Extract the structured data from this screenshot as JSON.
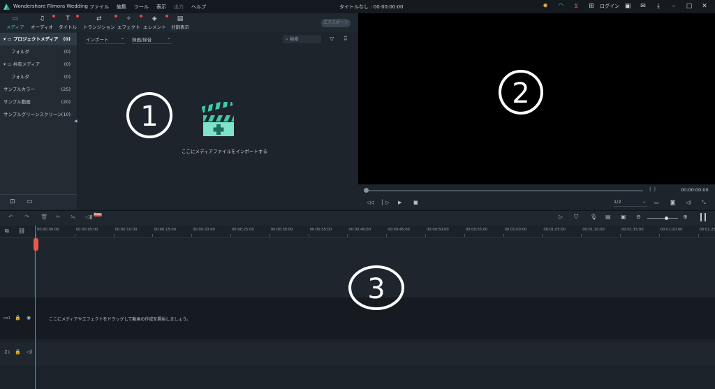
{
  "app": {
    "name": "Wondershare Filmora Wedding",
    "document_title": "タイトルなし : 00:00:00:00"
  },
  "menu": [
    "ファイル",
    "編集",
    "ツール",
    "表示",
    "出力",
    "ヘルプ"
  ],
  "titlebar_icons": {
    "login_label": "ログイン"
  },
  "toolbar": {
    "tabs": [
      {
        "label": "メディア",
        "icon": "folder-icon",
        "badge": false
      },
      {
        "label": "オーディオ",
        "icon": "music-icon",
        "badge": true
      },
      {
        "label": "タイトル",
        "icon": "text-icon",
        "badge": true
      },
      {
        "label": "トランジション",
        "icon": "transition-icon",
        "badge": true
      },
      {
        "label": "エフェクト",
        "icon": "effect-icon",
        "badge": true
      },
      {
        "label": "エレメント",
        "icon": "element-icon",
        "badge": true
      },
      {
        "label": "分割表示",
        "icon": "split-icon",
        "badge": false
      }
    ],
    "export_label": "エクスポート"
  },
  "media_panel": {
    "items": [
      {
        "label": "プロジェクトメディア",
        "count": "(0)"
      },
      {
        "label": "フォルダ",
        "count": "(0)"
      },
      {
        "label": "共有メディア",
        "count": "(0)"
      },
      {
        "label": "フォルダ",
        "count": "(0)"
      },
      {
        "label": "サンプルカラー",
        "count": "(25)"
      },
      {
        "label": "サンプル動画",
        "count": "(20)"
      },
      {
        "label": "サンプルグリーンスクリーン",
        "count": "(10)"
      }
    ],
    "import_dropdown": "インポート",
    "record_dropdown": "録画/録音",
    "search_placeholder": "検索",
    "import_hint": "ここにメディアファイルをインポートする"
  },
  "annotations": {
    "circle1": "1",
    "circle2": "2",
    "circle3": "3"
  },
  "preview": {
    "timecode": "00:00:00:00",
    "ratio": "1/2",
    "in_out_marks": "{ }"
  },
  "timeline": {
    "ruler": [
      "00:00:00:00",
      "00:00:05:00",
      "00:00:10:00",
      "00:00:15:00",
      "00:00:20:00",
      "00:00:25:00",
      "00:00:30:00",
      "00:00:35:00",
      "00:00:40:00",
      "00:00:45:00",
      "00:00:50:00",
      "00:00:55:00",
      "00:01:00:00",
      "00:01:05:00",
      "00:01:10:00",
      "00:01:15:00",
      "00:01:20:00",
      "00:01:25"
    ],
    "video_track_hint": "ここにメディアやエフェクトをドラッグして動画の作成を開始しましょう。",
    "track_video_number": "1",
    "track_audio_number": "1",
    "new_badge": "New"
  },
  "colors": {
    "accent": "#4fd1b5",
    "playhead": "#e85a4f",
    "badge": "#e24b4b"
  }
}
